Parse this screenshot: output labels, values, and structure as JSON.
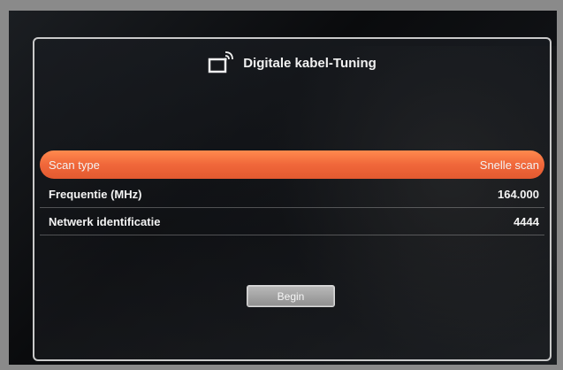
{
  "dialog": {
    "title": "Digitale kabel-Tuning",
    "title_icon": "tv-antenna-icon"
  },
  "settings": [
    {
      "label": "Scan type",
      "value": "Snelle scan",
      "selected": true
    },
    {
      "label": "Frequentie (MHz)",
      "value": "164.000",
      "selected": false
    },
    {
      "label": "Netwerk identificatie",
      "value": "4444",
      "selected": false
    }
  ],
  "actions": {
    "begin_label": "Begin"
  },
  "colors": {
    "highlight": "#f0673a",
    "frame": "#c9c9c9",
    "text": "#f3f3f3"
  }
}
